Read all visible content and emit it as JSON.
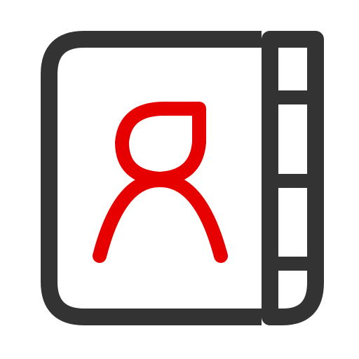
{
  "icon": {
    "name": "address-book-icon",
    "colors": {
      "outline": "#333333",
      "person": "#e60000",
      "fill": "#ffffff"
    }
  }
}
